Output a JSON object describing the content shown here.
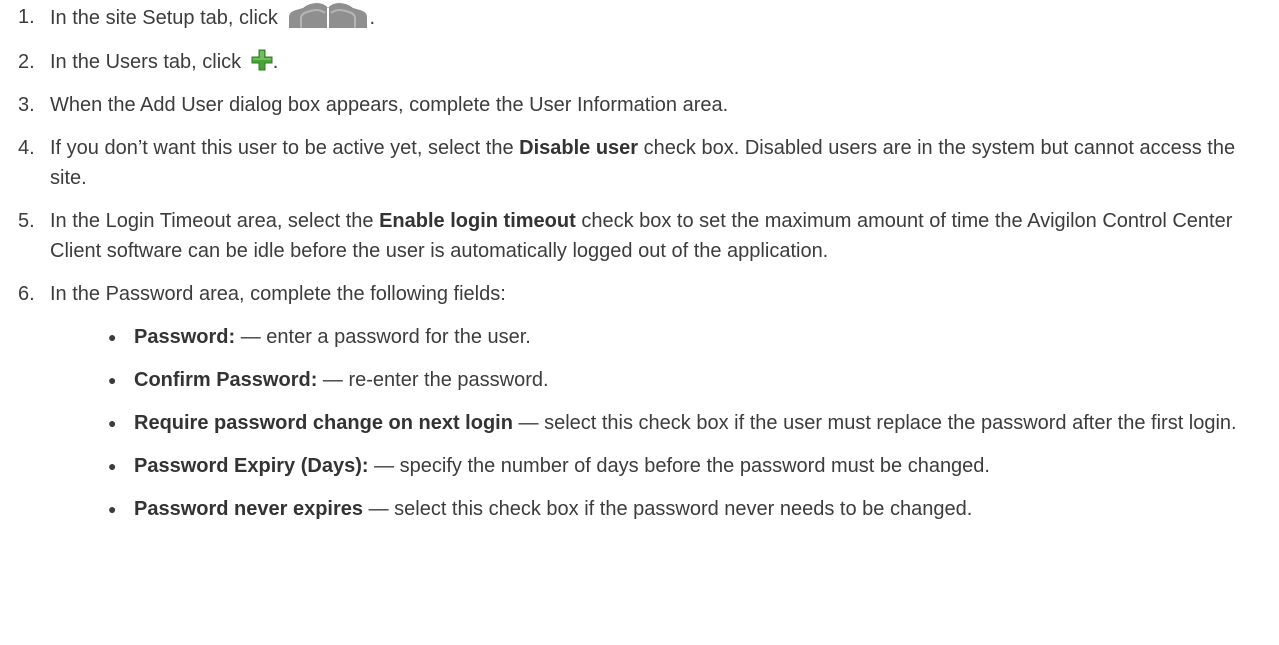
{
  "steps": [
    {
      "num": "1.",
      "text_before": "In the site Setup tab, click",
      "text_after": ".",
      "icon": "users-icon"
    },
    {
      "num": "2.",
      "text_before": "In the Users tab, click",
      "text_after": ".",
      "icon": "add-plus-icon"
    },
    {
      "num": "3.",
      "text": "When the Add User dialog box appears, complete the User Information area."
    },
    {
      "num": "4.",
      "text_before": "If you don’t want this user to be active yet, select the ",
      "bold": "Disable user",
      "text_after": " check box. Disabled users are in the system but cannot access the site."
    },
    {
      "num": "5.",
      "text_before": "In the Login Timeout area, select the ",
      "bold": "Enable login timeout",
      "text_after": " check box to set the maximum amount of time the Avigilon Control Center Client software can be idle before the user is automatically logged out of the application."
    },
    {
      "num": "6.",
      "text": "In the Password area, complete the following fields:"
    }
  ],
  "bullets": [
    {
      "bold": "Password:",
      "text": " — enter a password for the user."
    },
    {
      "bold": "Confirm Password:",
      "text": " — re-enter the password."
    },
    {
      "bold": "Require password change on next login",
      "text": " — select this check box if the user must replace the password after the first login."
    },
    {
      "bold": "Password Expiry (Days):",
      "text": " — specify the number of days before the password must be changed."
    },
    {
      "bold": "Password never expires",
      "text": " — select this check box if the password never needs to be changed."
    }
  ],
  "bullet_glyph": "●",
  "colors": {
    "text": "#3c3c3c",
    "icon_gray": "#8f8f8f",
    "plus_green": "#4aa33a"
  }
}
